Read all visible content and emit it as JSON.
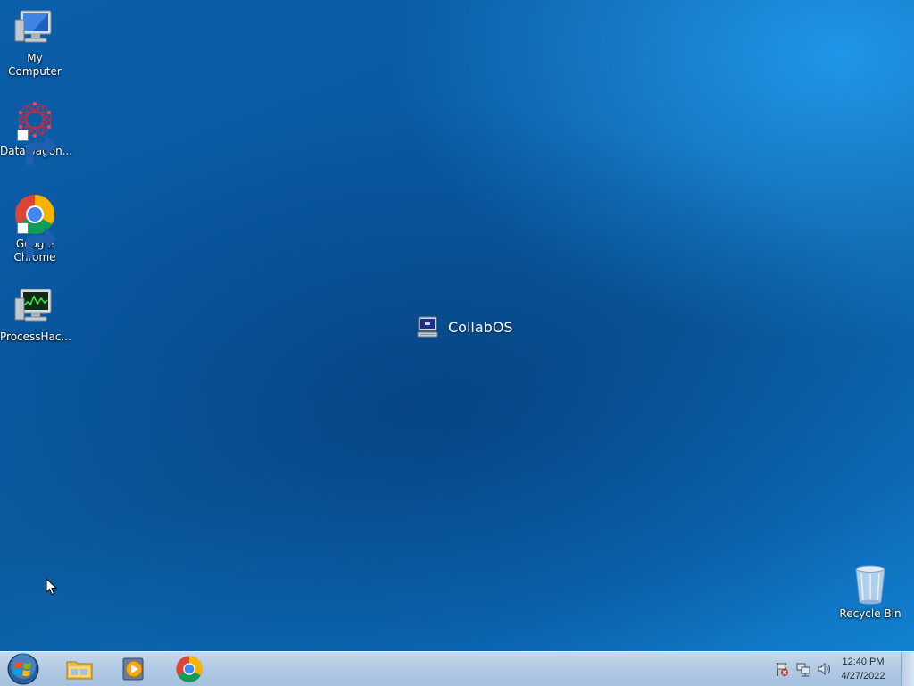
{
  "desktop": {
    "icons": [
      {
        "label": "My Computer",
        "icon": "computer-icon"
      },
      {
        "label": "DataWagon...",
        "icon": "datawagon-icon",
        "shortcut": true
      },
      {
        "label": "Google Chrome",
        "icon": "chrome-icon",
        "shortcut": true
      },
      {
        "label": "ProcessHac...",
        "icon": "processhacker-icon"
      },
      {
        "label": "Recycle Bin",
        "icon": "recycle-bin-icon"
      }
    ],
    "center_label": "CollabOS"
  },
  "taskbar": {
    "start_icon": "windows-start-icon",
    "pinned": [
      {
        "name": "Windows Explorer",
        "icon": "folder-icon"
      },
      {
        "name": "Windows Media Player",
        "icon": "media-player-icon"
      },
      {
        "name": "Google Chrome",
        "icon": "chrome-icon"
      }
    ],
    "tray": {
      "icons": [
        "action-center-flag-icon",
        "network-icon",
        "volume-icon"
      ],
      "time": "12:40 PM",
      "date": "4/27/2022"
    }
  },
  "colors": {
    "accent": "#0b5ea8",
    "taskbar": "#b3cbe4"
  }
}
